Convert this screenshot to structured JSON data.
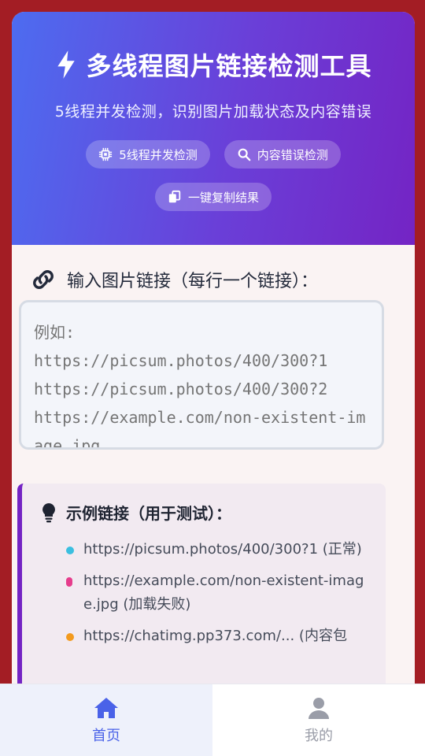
{
  "header": {
    "title": "多线程图片链接检测工具",
    "subtitle": "5线程并发检测，识别图片加载状态及内容错误",
    "chips": [
      {
        "label": "5线程并发检测",
        "icon": "chip-icon"
      },
      {
        "label": "内容错误检测",
        "icon": "search-icon"
      },
      {
        "label": "一键复制结果",
        "icon": "copy-icon"
      }
    ]
  },
  "input": {
    "label": "输入图片链接（每行一个链接）：",
    "placeholder": "例如:\nhttps://picsum.photos/400/300?1\nhttps://picsum.photos/400/300?2\nhttps://example.com/non-existent-image.jpg"
  },
  "examples": {
    "title": "示例链接（用于测试）：",
    "items": [
      {
        "text": "https://picsum.photos/400/300?1 (正常)",
        "color": "#3bbfe0"
      },
      {
        "text": "https://example.com/non-existent-image.jpg (加载失败)",
        "color": "#e63c8c"
      },
      {
        "text": "https://chatimg.pp373.com/... (内容包",
        "color": "#f39a1e"
      }
    ]
  },
  "nav": {
    "home": "首页",
    "mine": "我的"
  }
}
